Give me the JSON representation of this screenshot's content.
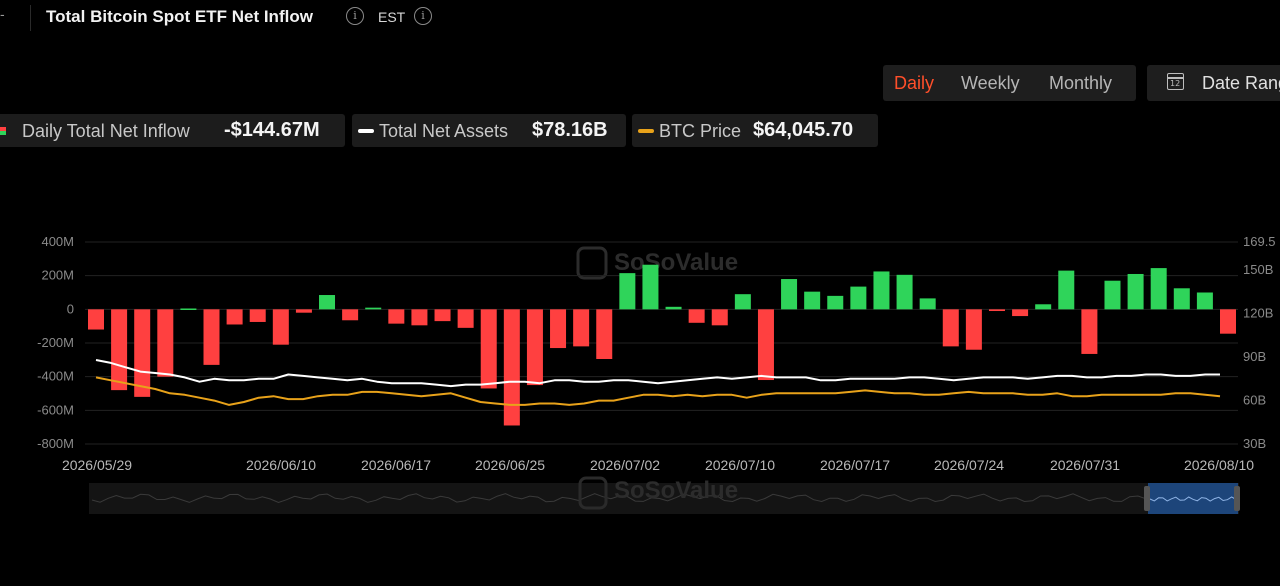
{
  "header": {
    "dash": "-",
    "title": "Total Bitcoin Spot ETF Net Inflow",
    "timezone": "EST"
  },
  "period_tabs": [
    {
      "label": "Daily",
      "active": true
    },
    {
      "label": "Weekly",
      "active": false
    },
    {
      "label": "Monthly",
      "active": false
    }
  ],
  "date_range": {
    "label": "Date Range",
    "icon": "calendar-icon",
    "icon_text": "12"
  },
  "legend": [
    {
      "label": "Daily Total Net Inflow",
      "value": "-$144.67M",
      "swatch": [
        "#ff4040",
        "#2fd45a"
      ]
    },
    {
      "label": "Total Net Assets",
      "value": "$78.16B",
      "swatch": "#ffffff"
    },
    {
      "label": "BTC Price",
      "value": "$64,045.70",
      "swatch": "#e8a21a"
    }
  ],
  "watermark": "SoSoValue",
  "colors": {
    "positive": "#2fd45a",
    "negative": "#ff4040",
    "net_assets": "#ffffff",
    "btc_price": "#e8a21a",
    "navigator": "#1f4e8c"
  },
  "chart_data": {
    "type": "bar",
    "title": "Total Bitcoin Spot ETF Net Inflow",
    "y_left": {
      "ticks": [
        "400M",
        "200M",
        "0",
        "-200M",
        "-400M",
        "-600M",
        "-800M"
      ],
      "range": [
        -800,
        400
      ],
      "unit": "M"
    },
    "y_right": {
      "ticks": [
        "169.5",
        "150B",
        "120B",
        "90B",
        "60B",
        "30B"
      ],
      "range": [
        30,
        169.5
      ],
      "unit": "B"
    },
    "x_tick_labels": [
      "2026/05/29",
      "2026/06/10",
      "2026/06/17",
      "2026/06/25",
      "2026/07/02",
      "2026/07/10",
      "2026/07/17",
      "2026/07/24",
      "2026/07/31",
      "2026/08/10"
    ],
    "bar_values_musd": [
      -120,
      -480,
      -520,
      -400,
      5,
      -330,
      -90,
      -75,
      -210,
      -20,
      85,
      -65,
      10,
      -85,
      -95,
      -70,
      -110,
      -470,
      -690,
      -450,
      -230,
      -220,
      -295,
      215,
      265,
      15,
      -80,
      -95,
      90,
      -420,
      180,
      105,
      80,
      135,
      225,
      205,
      65,
      -220,
      -240,
      -10,
      -40,
      30,
      230,
      -265,
      170,
      210,
      245,
      125,
      100,
      -144.67
    ],
    "series": [
      {
        "name": "Total Net Assets",
        "axis": "right",
        "values_busd": [
          88,
          86,
          83,
          80,
          79,
          78,
          76,
          73,
          75,
          74,
          74,
          75,
          75,
          78,
          77,
          76,
          75,
          74,
          75,
          73,
          72,
          72,
          72,
          71,
          70,
          71,
          71,
          72,
          73,
          73,
          72,
          74,
          74,
          73,
          73,
          74,
          74,
          73,
          72,
          73,
          74,
          75,
          76,
          75,
          76,
          77,
          76,
          76,
          76,
          74,
          74,
          75,
          75,
          75,
          75,
          76,
          76,
          75,
          74,
          75,
          76,
          76,
          76,
          75,
          76,
          77,
          77,
          76,
          76,
          77,
          77,
          78,
          78,
          77,
          77,
          78,
          78
        ]
      },
      {
        "name": "BTC Price",
        "axis": "right",
        "values_busd": [
          76,
          74,
          72,
          70,
          68,
          65,
          64,
          62,
          60,
          57,
          59,
          62,
          63,
          61,
          61,
          63,
          64,
          64,
          66,
          66,
          65,
          64,
          63,
          64,
          65,
          62,
          59,
          58,
          57,
          57,
          58,
          58,
          57,
          58,
          60,
          60,
          62,
          64,
          64,
          63,
          64,
          63,
          64,
          64,
          62,
          64,
          65,
          65,
          65,
          65,
          65,
          66,
          67,
          66,
          65,
          65,
          64,
          64,
          65,
          66,
          65,
          65,
          65,
          64,
          64,
          65,
          63,
          63,
          64,
          64,
          64,
          64,
          64,
          65,
          65,
          64,
          63
        ]
      }
    ],
    "grid": true,
    "legend_position": "top-left"
  }
}
